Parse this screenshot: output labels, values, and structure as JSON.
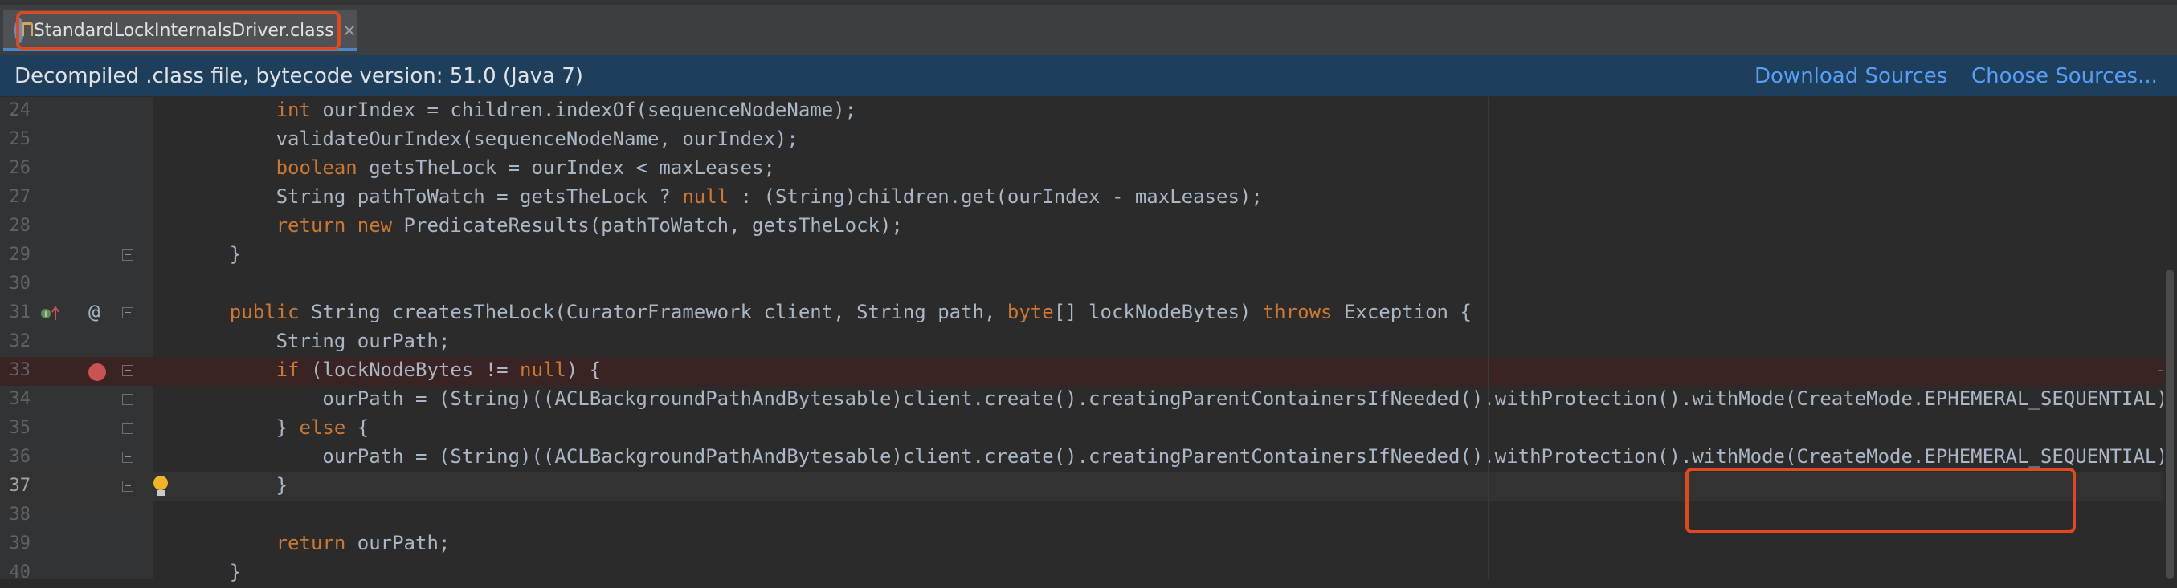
{
  "tab": {
    "label": "StandardLockInternalsDriver.class",
    "close": "×",
    "icon": "java-class-icon"
  },
  "infobar": {
    "message": "Decompiled .class file, bytecode version: 51.0 (Java 7)",
    "download_sources": "Download Sources",
    "choose_sources": "Choose Sources..."
  },
  "colors": {
    "accent": "#4a88c7",
    "highlight_box": "#e0491d",
    "link": "#589df6",
    "keyword": "#cc7832",
    "breakpoint": "#c75450"
  },
  "editor": {
    "lines": [
      {
        "num": "24",
        "indent": "        ",
        "tokens": [
          {
            "t": "int",
            "k": true
          },
          {
            "t": " ourIndex = children.indexOf(sequenceNodeName);",
            "k": false
          }
        ]
      },
      {
        "num": "25",
        "indent": "        ",
        "tokens": [
          {
            "t": "validateOurIndex(sequenceNodeName, ourIndex);",
            "k": false
          }
        ]
      },
      {
        "num": "26",
        "indent": "        ",
        "tokens": [
          {
            "t": "boolean",
            "k": true
          },
          {
            "t": " getsTheLock = ourIndex < maxLeases;",
            "k": false
          }
        ]
      },
      {
        "num": "27",
        "indent": "        ",
        "tokens": [
          {
            "t": "String pathToWatch = getsTheLock ? ",
            "k": false
          },
          {
            "t": "null",
            "k": true
          },
          {
            "t": " : (String)children.get(ourIndex - maxLeases);",
            "k": false
          }
        ]
      },
      {
        "num": "28",
        "indent": "        ",
        "tokens": [
          {
            "t": "return new",
            "k": true
          },
          {
            "t": " PredicateResults(pathToWatch, getsTheLock);",
            "k": false
          }
        ]
      },
      {
        "num": "29",
        "indent": "    ",
        "tokens": [
          {
            "t": "}",
            "k": false
          }
        ]
      },
      {
        "num": "30",
        "indent": "",
        "tokens": []
      },
      {
        "num": "31",
        "indent": "    ",
        "tokens": [
          {
            "t": "public",
            "k": true
          },
          {
            "t": " String createsTheLock(CuratorFramework client, String path, ",
            "k": false
          },
          {
            "t": "byte",
            "k": true
          },
          {
            "t": "[] lockNodeBytes) ",
            "k": false
          },
          {
            "t": "throws",
            "k": true
          },
          {
            "t": " Exception {",
            "k": false
          }
        ]
      },
      {
        "num": "32",
        "indent": "        ",
        "tokens": [
          {
            "t": "String ourPath;",
            "k": false
          }
        ]
      },
      {
        "num": "33",
        "indent": "        ",
        "tokens": [
          {
            "t": "if",
            "k": true
          },
          {
            "t": " (lockNodeBytes != ",
            "k": false
          },
          {
            "t": "null",
            "k": true
          },
          {
            "t": ") {",
            "k": false
          }
        ]
      },
      {
        "num": "34",
        "indent": "            ",
        "tokens": [
          {
            "t": "ourPath = (String)((ACLBackgroundPathAndBytesable)client.create().creatingParentContainersIfNeeded().withProtection().withMode(CreateMode.EPHEMERAL_SEQUENTIAL)).forPath(",
            "k": false
          }
        ]
      },
      {
        "num": "35",
        "indent": "        ",
        "tokens": [
          {
            "t": "} ",
            "k": false
          },
          {
            "t": "else",
            "k": true
          },
          {
            "t": " {",
            "k": false
          }
        ]
      },
      {
        "num": "36",
        "indent": "            ",
        "tokens": [
          {
            "t": "ourPath = (String)((ACLBackgroundPathAndBytesable)client.create().creatingParentContainersIfNeeded().withProtection().withMode(CreateMode.EPHEMERAL_SEQUENTIAL)).forPath(",
            "k": false
          }
        ]
      },
      {
        "num": "37",
        "indent": "        ",
        "tokens": [
          {
            "t": "}",
            "k": false
          }
        ]
      },
      {
        "num": "38",
        "indent": "",
        "tokens": []
      },
      {
        "num": "39",
        "indent": "        ",
        "tokens": [
          {
            "t": "return",
            "k": true
          },
          {
            "t": " ourPath;",
            "k": false
          }
        ]
      },
      {
        "num": "40",
        "indent": "    ",
        "tokens": [
          {
            "t": "}",
            "k": false
          }
        ]
      }
    ],
    "annotation_symbol": "@"
  }
}
